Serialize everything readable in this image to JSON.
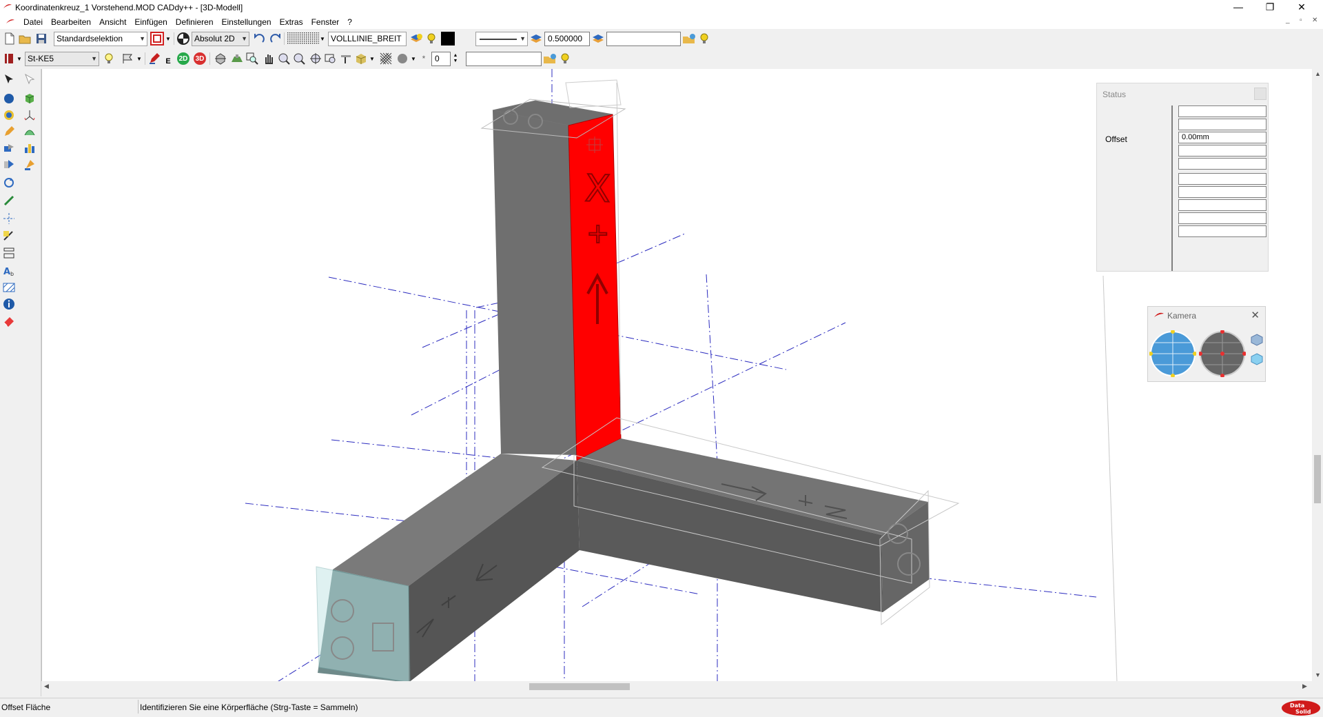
{
  "window": {
    "title": "Koordinatenkreuz_1 Vorstehend.MOD   CADdy++ - [3D-Modell]",
    "controls": [
      "—",
      "❐",
      "✕"
    ]
  },
  "menubar": {
    "items": [
      "Datei",
      "Bearbeiten",
      "Ansicht",
      "Einfügen",
      "Definieren",
      "Einstellungen",
      "Extras",
      "Fenster",
      "?"
    ],
    "mdi_controls": [
      "_",
      "▫",
      "✕"
    ]
  },
  "toolbar1": {
    "selection_mode": "Standardselektion",
    "coord_mode": "Absolut 2D",
    "linetype": "VOLLLINIE_BREIT",
    "line_width": "0.500000",
    "empty_field": ""
  },
  "toolbar2": {
    "material": "St-KE5",
    "label_2d": "2D",
    "label_3d": "3D",
    "letter_e": "E",
    "counter_value": "0",
    "empty_field": ""
  },
  "status_panel": {
    "title": "Status",
    "offset_label": "Offset",
    "offset_value": "0.00mm",
    "rows": [
      "",
      "",
      "0.00mm",
      "",
      "",
      "",
      "",
      "",
      "",
      ""
    ]
  },
  "camera_panel": {
    "title": "Kamera"
  },
  "statusbar": {
    "mode": "Offset Fläche",
    "hint": "Identifizieren Sie eine Körperfläche (Strg-Taste = Sammeln)",
    "brand": "Data Solid"
  },
  "colors": {
    "highlight_face": "#ff0000",
    "axis_line": "#2b2bbf",
    "brand_red": "#d01b1b"
  }
}
